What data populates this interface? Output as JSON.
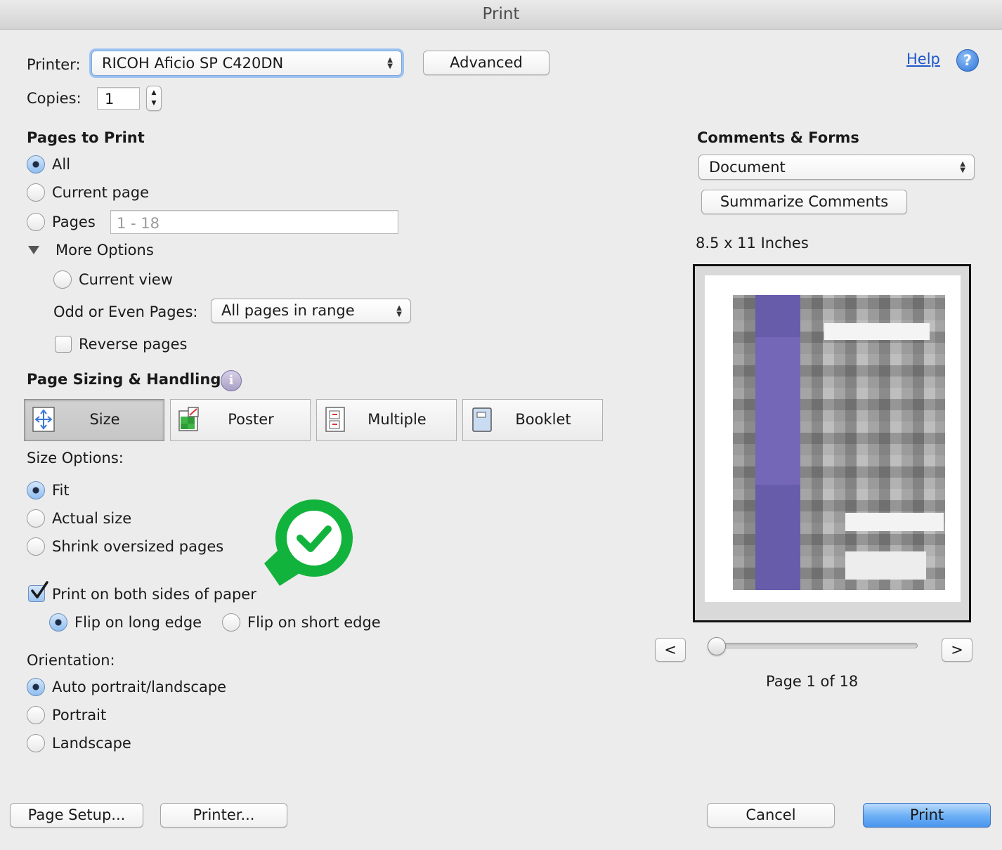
{
  "window": {
    "title": "Print"
  },
  "printer": {
    "label": "Printer:",
    "value": "RICOH Aficio SP C420DN",
    "advanced_label": "Advanced"
  },
  "help": {
    "label": "Help",
    "icon_glyph": "?"
  },
  "copies": {
    "label": "Copies:",
    "value": "1"
  },
  "pages_to_print": {
    "title": "Pages to Print",
    "options": {
      "all": "All",
      "current_page": "Current page",
      "pages": "Pages"
    },
    "selected": "all",
    "range_placeholder": "1 - 18",
    "more_options": {
      "label": "More Options",
      "current_view": "Current view",
      "odd_even_label": "Odd or Even Pages:",
      "odd_even_value": "All pages in range",
      "reverse_pages": "Reverse pages"
    }
  },
  "page_sizing": {
    "title": "Page Sizing & Handling",
    "info_glyph": "i",
    "tabs": {
      "size": "Size",
      "poster": "Poster",
      "multiple": "Multiple",
      "booklet": "Booklet"
    },
    "selected_tab": "size",
    "size_options_label": "Size Options:",
    "size_options": {
      "fit": "Fit",
      "actual": "Actual size",
      "shrink": "Shrink oversized pages"
    },
    "selected_size": "fit"
  },
  "duplex": {
    "label": "Print on both sides of paper",
    "checked": true,
    "long_edge": "Flip on long edge",
    "short_edge": "Flip on short edge",
    "selected": "long_edge"
  },
  "orientation": {
    "label": "Orientation:",
    "options": {
      "auto": "Auto portrait/landscape",
      "portrait": "Portrait",
      "landscape": "Landscape"
    },
    "selected": "auto"
  },
  "comments_forms": {
    "title": "Comments & Forms",
    "value": "Document",
    "summarize_label": "Summarize Comments"
  },
  "preview": {
    "paper_size": "8.5 x 11 Inches",
    "prev_label": "<",
    "next_label": ">",
    "page_status": "Page 1 of 18",
    "current_page": 1,
    "total_pages": 18
  },
  "footer": {
    "page_setup": "Page Setup...",
    "printer": "Printer...",
    "cancel": "Cancel",
    "print": "Print"
  },
  "colors": {
    "accent": "#4a8ff0",
    "badge_green": "#12b33d",
    "link": "#1f57c9"
  }
}
